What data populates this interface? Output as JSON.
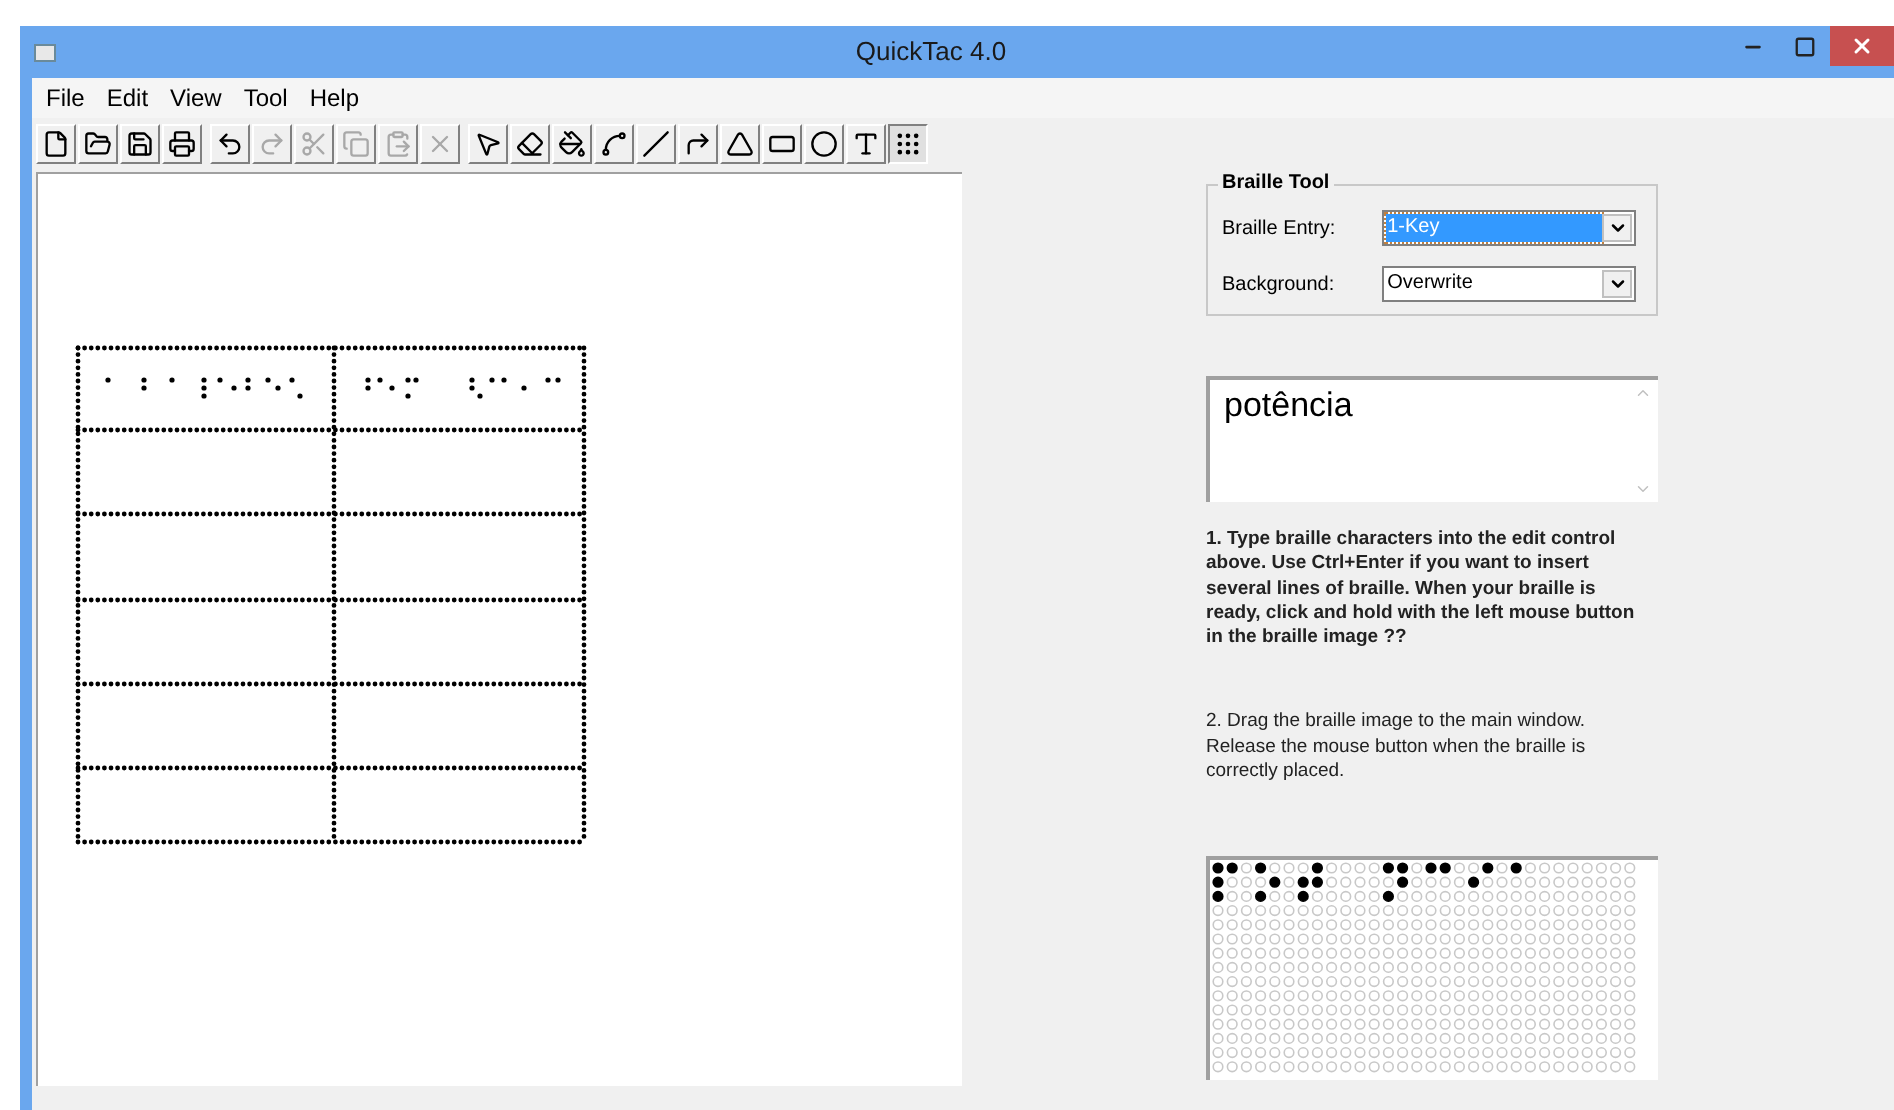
{
  "window": {
    "title": "QuickTac 4.0"
  },
  "menu": [
    "File",
    "Edit",
    "View",
    "Tool",
    "Help"
  ],
  "toolbar": [
    [
      {
        "kind": "new",
        "disabled": false,
        "selected": false
      },
      {
        "kind": "open",
        "disabled": false,
        "selected": false
      },
      {
        "kind": "save",
        "disabled": false,
        "selected": false
      },
      {
        "kind": "print",
        "disabled": false,
        "selected": false
      }
    ],
    [
      {
        "kind": "undo",
        "disabled": false,
        "selected": false
      },
      {
        "kind": "redo",
        "disabled": true,
        "selected": false
      },
      {
        "kind": "cut",
        "disabled": true,
        "selected": false
      },
      {
        "kind": "copy",
        "disabled": true,
        "selected": false
      },
      {
        "kind": "paste",
        "disabled": true,
        "selected": false
      },
      {
        "kind": "delete",
        "disabled": true,
        "selected": false
      }
    ],
    [
      {
        "kind": "select",
        "disabled": false,
        "selected": false
      },
      {
        "kind": "eraser",
        "disabled": false,
        "selected": false
      },
      {
        "kind": "fill",
        "disabled": false,
        "selected": false
      },
      {
        "kind": "freehand",
        "disabled": false,
        "selected": false
      },
      {
        "kind": "line",
        "disabled": false,
        "selected": false
      },
      {
        "kind": "arc",
        "disabled": false,
        "selected": false
      },
      {
        "kind": "triangle",
        "disabled": false,
        "selected": false
      },
      {
        "kind": "rectangle",
        "disabled": false,
        "selected": false
      },
      {
        "kind": "ellipse",
        "disabled": false,
        "selected": false
      },
      {
        "kind": "text",
        "disabled": false,
        "selected": false
      },
      {
        "kind": "braille",
        "disabled": false,
        "selected": true
      }
    ]
  ],
  "braille_tool": {
    "title": "Braille Tool",
    "fields": [
      {
        "label": "Braille Entry:",
        "value": "1-Key",
        "focused": true
      },
      {
        "label": "Background:",
        "value": "Overwrite",
        "focused": false
      }
    ]
  },
  "edit_box": {
    "value": "potência"
  },
  "instructions": [
    {
      "text": "1. Type braille characters into the edit control above.  Use Ctrl+Enter if you want to insert several lines of braille. When your braille is ready, click and hold with the left mouse button in the braille image ??",
      "bold": true
    },
    {
      "text": "2. Drag the braille image to the main window. Release the mouse button when the braille is correctly placed.",
      "bold": false
    }
  ]
}
